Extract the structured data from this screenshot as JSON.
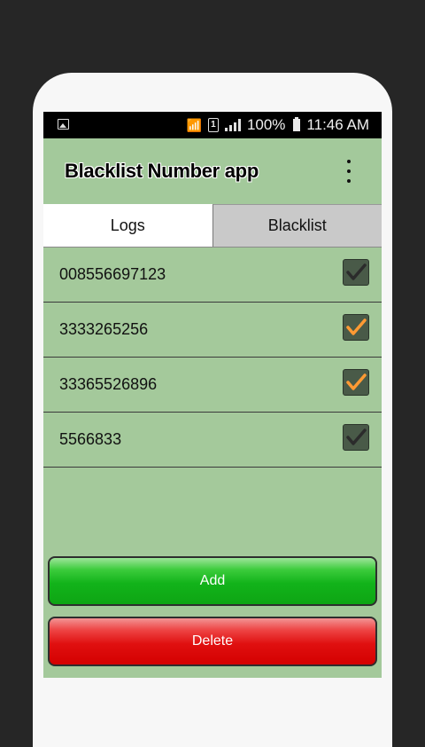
{
  "status_bar": {
    "battery": "100%",
    "time": "11:46 AM",
    "sim_label": "1"
  },
  "app_bar": {
    "title": "Blacklist Number app"
  },
  "tabs": [
    {
      "label": "Logs",
      "selected": true
    },
    {
      "label": "Blacklist",
      "selected": false
    }
  ],
  "entries": [
    {
      "number": "008556697123",
      "checked": true,
      "check_color": "#2b2b2b"
    },
    {
      "number": "3333265256",
      "checked": true,
      "check_color": "#ff9a33"
    },
    {
      "number": "33365526896",
      "checked": true,
      "check_color": "#ff9a33"
    },
    {
      "number": "5566833",
      "checked": true,
      "check_color": "#2b2b2b"
    }
  ],
  "buttons": {
    "add_label": "Add",
    "delete_label": "Delete"
  },
  "colors": {
    "background": "#a4c99b",
    "add_button": "#12b31a",
    "delete_button": "#e01010"
  }
}
